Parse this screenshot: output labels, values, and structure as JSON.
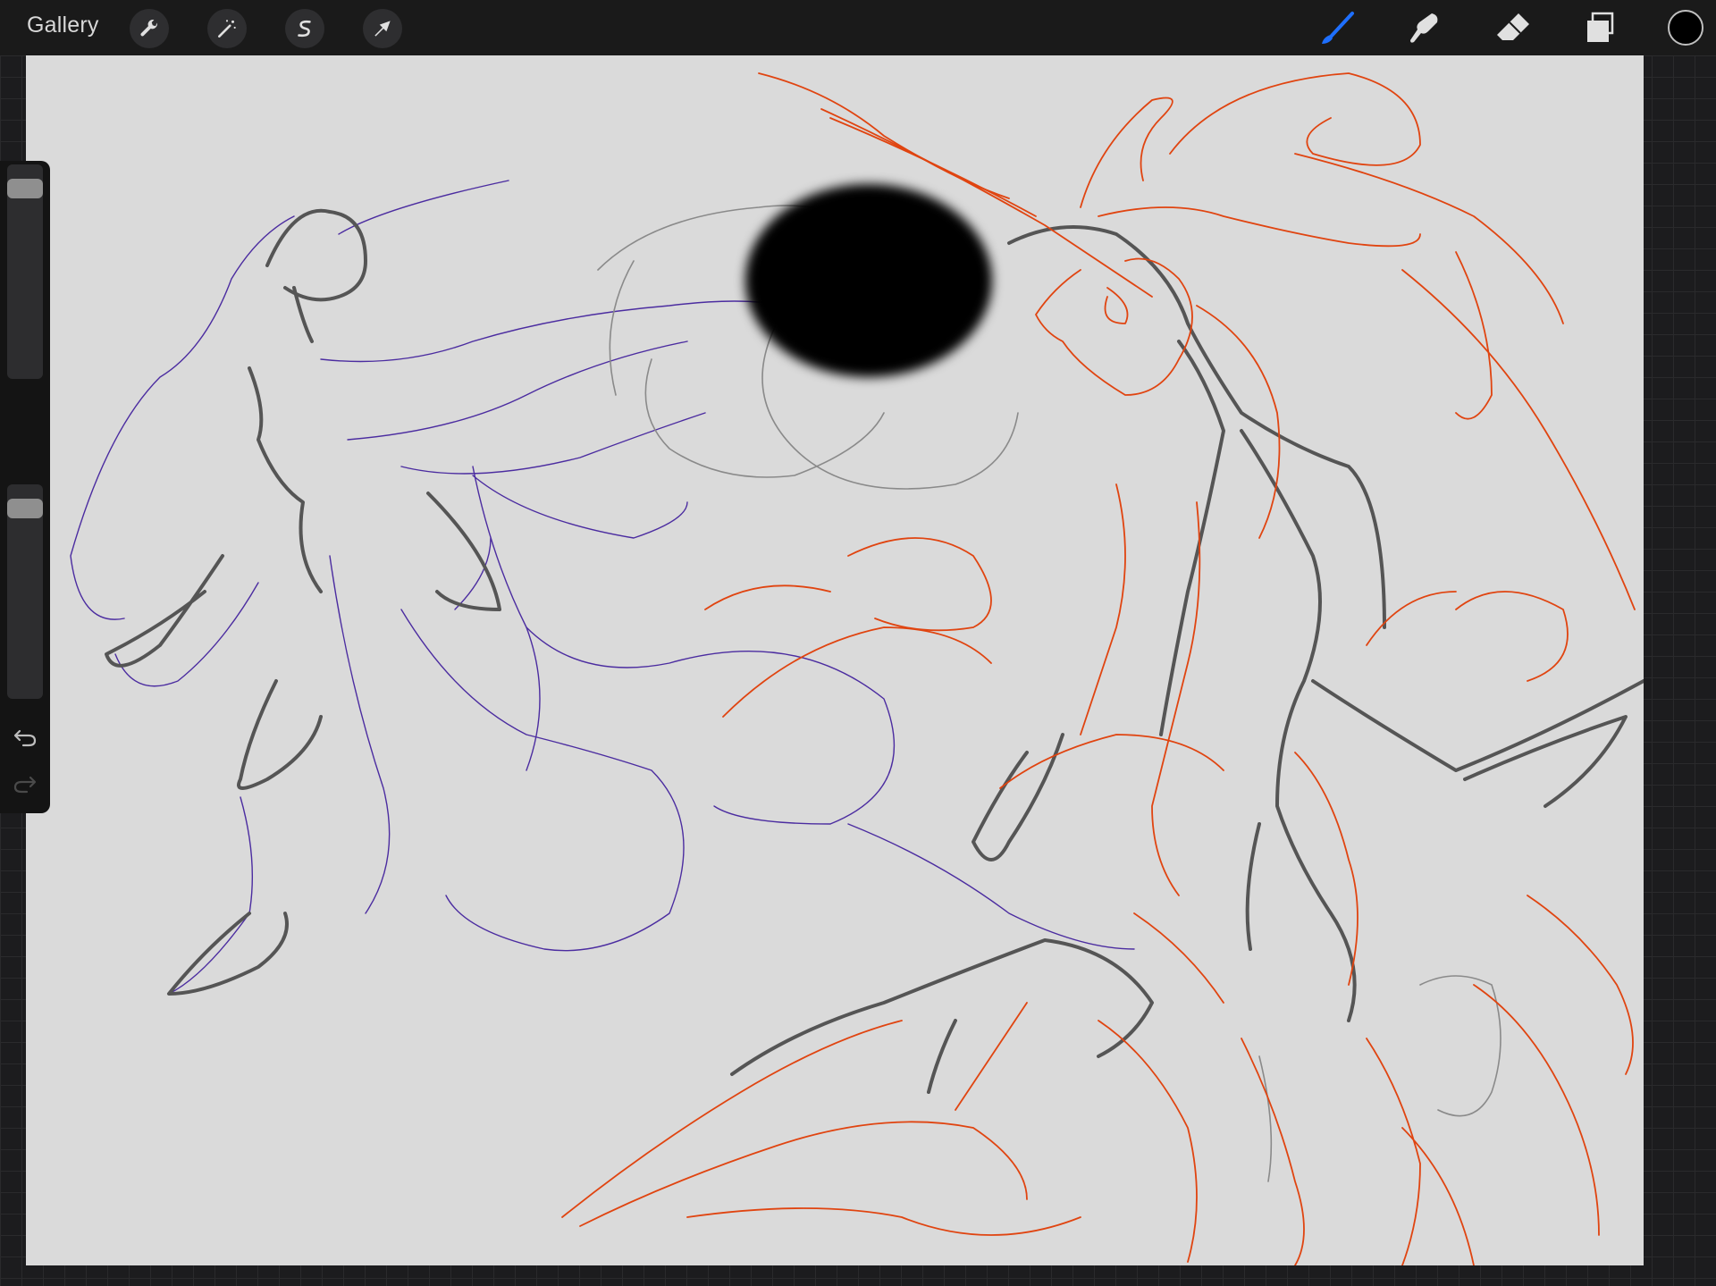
{
  "topbar": {
    "gallery_label": "Gallery",
    "left_tools": [
      {
        "name": "actions",
        "icon": "wrench-icon"
      },
      {
        "name": "adjustments",
        "icon": "magic-wand-icon"
      },
      {
        "name": "selection",
        "icon": "selection-s-icon"
      },
      {
        "name": "transform",
        "icon": "arrow-cursor-icon"
      }
    ],
    "right_tools": [
      {
        "name": "brush",
        "icon": "brush-icon",
        "active": true
      },
      {
        "name": "smudge",
        "icon": "smudge-icon"
      },
      {
        "name": "eraser",
        "icon": "eraser-icon"
      },
      {
        "name": "layers",
        "icon": "layers-icon"
      }
    ],
    "current_color": "#000000",
    "accent_color": "#1e6fff"
  },
  "sidebar": {
    "brush_size_slider": {
      "icon": "size-slider",
      "level": 0.95
    },
    "modify_button": {
      "icon": "square-icon"
    },
    "opacity_slider": {
      "icon": "opacity-slider",
      "level": 0.95
    },
    "undo": {
      "icon": "undo-icon"
    },
    "redo": {
      "icon": "redo-icon",
      "enabled": false
    }
  },
  "canvas": {
    "background": "#dadada",
    "stroke_colors": [
      "#4b2ca0",
      "#e04410",
      "#555555",
      "#8a8a8a",
      "#000000"
    ]
  }
}
